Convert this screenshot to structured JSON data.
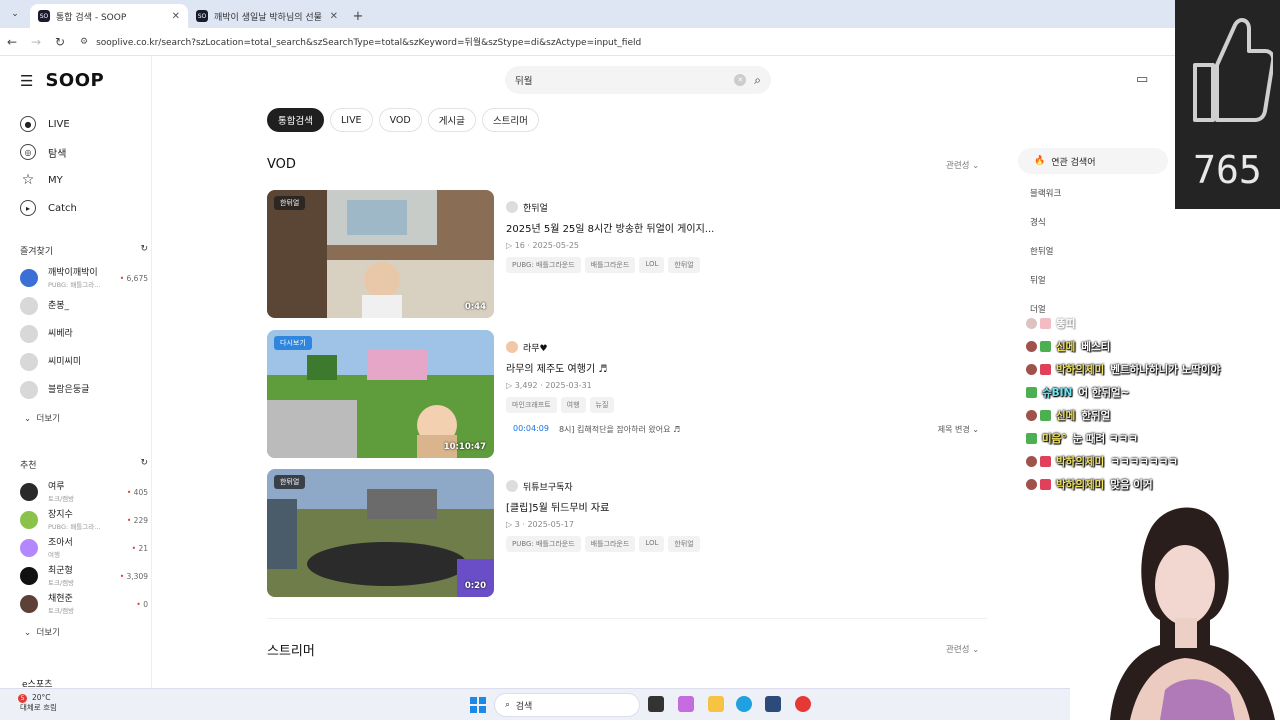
{
  "browser": {
    "tabs": [
      {
        "title": "통합 검색 - SOOP",
        "active": true
      },
      {
        "title": "깨박이 생일날 박하님의 선물",
        "active": false
      }
    ],
    "url": "sooplive.co.kr/search?szLocation=total_search&szSearchType=total&szKeyword=뒤월&szStype=di&szActype=input_field",
    "favicon_text": "SO"
  },
  "header": {
    "logo": "SOOP",
    "search_value": "뒤월"
  },
  "sidebar": {
    "nav": [
      {
        "label": "LIVE",
        "icon": "live-icon"
      },
      {
        "label": "탐색",
        "icon": "compass-icon"
      },
      {
        "label": "MY",
        "icon": "star-icon"
      },
      {
        "label": "Catch",
        "icon": "catch-icon"
      }
    ],
    "favorites_title": "즐겨찾기",
    "favorites": [
      {
        "name": "깨박이깨박이",
        "sub": "PUBG: 배틀그라...",
        "count": "6,675"
      },
      {
        "name": "춘봉_",
        "sub": "",
        "count": ""
      },
      {
        "name": "씨베라",
        "sub": "",
        "count": ""
      },
      {
        "name": "씨미씨미",
        "sub": "",
        "count": ""
      },
      {
        "name": "블랑은둥글",
        "sub": "",
        "count": ""
      }
    ],
    "more_label": "더보기",
    "recommend_title": "추천",
    "recommend": [
      {
        "name": "여루",
        "sub": "토크/캠방",
        "count": "405"
      },
      {
        "name": "장지수",
        "sub": "PUBG: 배틀그라...",
        "count": "229"
      },
      {
        "name": "조아서",
        "sub": "여행",
        "count": "21"
      },
      {
        "name": "최군형",
        "sub": "토크/캠방",
        "count": "3,309"
      },
      {
        "name": "채현준",
        "sub": "토크/캠방",
        "count": "0"
      }
    ],
    "more_label2": "더보기",
    "esports": "e스포츠"
  },
  "filters": [
    "통합검색",
    "LIVE",
    "VOD",
    "게시글",
    "스트리머"
  ],
  "vod_section": {
    "title": "VOD",
    "sort": "관련성",
    "items": [
      {
        "badge": "한뒤얼",
        "duration": "0:44",
        "author": "한뒤얼",
        "title": "2025년 5월 25일 8시간 방송한 뒤얼이 게이지...",
        "views": "16",
        "date": "2025-05-25",
        "tags": [
          "PUBG: 배틀그라운드",
          "배틀그라운드",
          "LOL",
          "한뒤얼"
        ]
      },
      {
        "badge": "다시보기",
        "duration": "10:10:47",
        "author": "라무♥",
        "title": "라무의 제주도 여행기 ♬",
        "views": "3,492",
        "date": "2025-03-31",
        "tags": [
          "마인크래프트",
          "여행",
          "뉴질"
        ],
        "chapter_time": "00:04:09",
        "chapter_text": "8시] 킴해적단을 잡아하러 왔어요 ♬",
        "chapter_edit": "제목 변경"
      },
      {
        "badge": "한뒤얼",
        "duration": "0:20",
        "author": "뒤튜브구독자",
        "title": "[클립]5월 뒤드무비 자료",
        "views": "3",
        "date": "2025-05-17",
        "tags": [
          "PUBG: 배틀그라운드",
          "배틀그라운드",
          "LOL",
          "한뒤얼"
        ]
      }
    ]
  },
  "streamer_section": {
    "title": "스트리머",
    "sort": "관련성"
  },
  "related": {
    "title": "연관 검색어",
    "items": [
      "블랙워크",
      "경식",
      "한뒤얼",
      "뒤얼",
      "더얼"
    ]
  },
  "overlay": {
    "like_count": "765",
    "chat": [
      {
        "nick": "",
        "msg": "뚱띠",
        "faded": true
      },
      {
        "nick": "신메",
        "msg": "베스티",
        "faded": false,
        "cyan": false
      },
      {
        "nick": "박하의제미",
        "msg": "벤트하나하니가 노딱이야",
        "faded": false
      },
      {
        "nick": "슈BIN",
        "msg": "어 한뒤얼~",
        "faded": false,
        "cyan": true
      },
      {
        "nick": "신메",
        "msg": "한뒤얼",
        "faded": false
      },
      {
        "nick": "미음°",
        "msg": "눈 때려 ㅋㅋㅋ",
        "faded": false
      },
      {
        "nick": "박하의제미",
        "msg": "ㅋㅋㅋㅋㅋㅋㅋ",
        "faded": false
      },
      {
        "nick": "박하의제미",
        "msg": "맞음 이거",
        "faded": false
      }
    ]
  },
  "taskbar": {
    "weather_temp": "20°C",
    "weather_desc": "대체로 흐림",
    "weather_badge": "5",
    "search_label": "검색"
  }
}
